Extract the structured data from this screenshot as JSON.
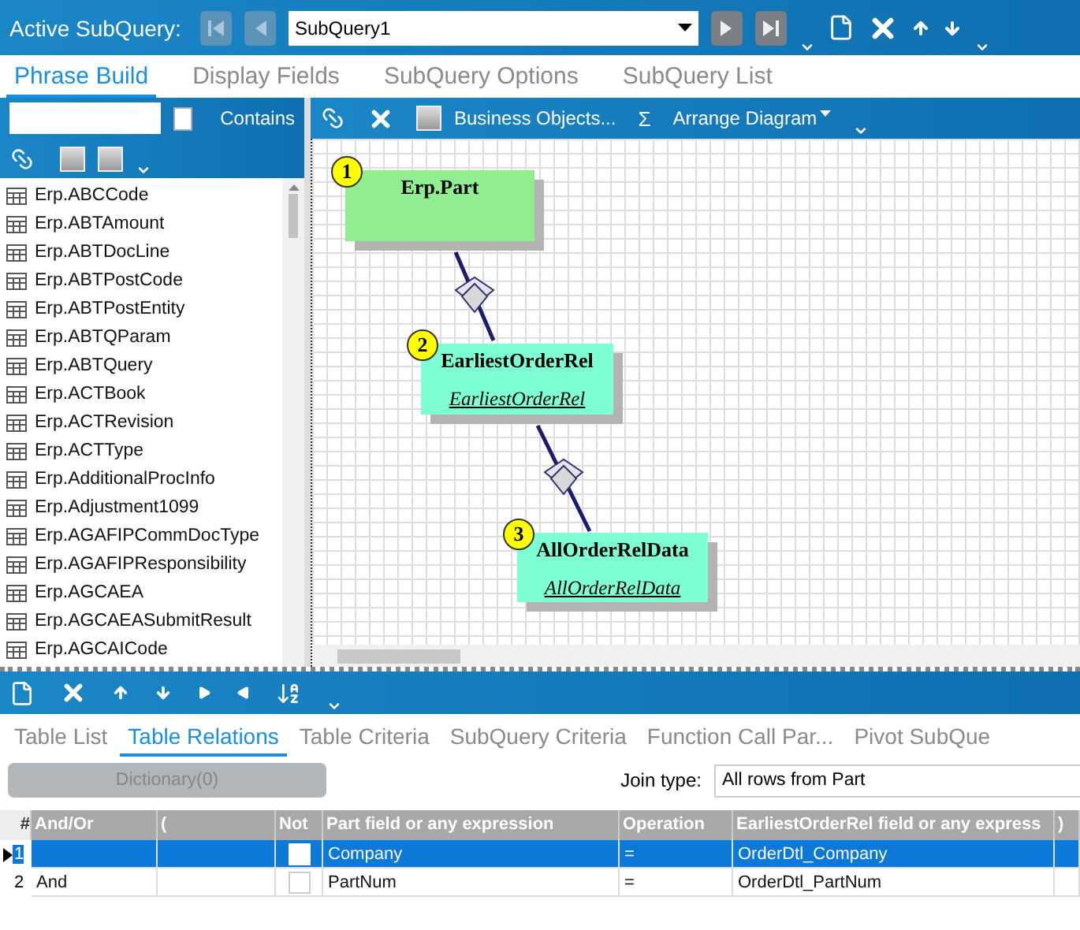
{
  "top_bar": {
    "label": "Active SubQuery:",
    "subquery": "SubQuery1"
  },
  "tabs": [
    {
      "label": "Phrase Build",
      "selected": true
    },
    {
      "label": "Display Fields",
      "selected": false
    },
    {
      "label": "SubQuery Options",
      "selected": false
    },
    {
      "label": "SubQuery List",
      "selected": false
    }
  ],
  "left_panel": {
    "contains_label": "Contains",
    "contains_checked": false,
    "items": [
      "Erp.ABCCode",
      "Erp.ABTAmount",
      "Erp.ABTDocLine",
      "Erp.ABTPostCode",
      "Erp.ABTPostEntity",
      "Erp.ABTQParam",
      "Erp.ABTQuery",
      "Erp.ACTBook",
      "Erp.ACTRevision",
      "Erp.ACTType",
      "Erp.AdditionalProcInfo",
      "Erp.Adjustment1099",
      "Erp.AGAFIPCommDocType",
      "Erp.AGAFIPResponsibility",
      "Erp.AGCAEA",
      "Erp.AGCAEASubmitResult",
      "Erp.AGCAICode"
    ]
  },
  "diagram_toolbar": {
    "business_objects": "Business Objects...",
    "sigma": "Σ",
    "arrange": "Arrange Diagram"
  },
  "diagram": {
    "nodes": [
      {
        "badge": "1",
        "title": "Erp.Part",
        "color": "#90ee90"
      },
      {
        "badge": "2",
        "title": "EarliestOrderRel",
        "subtitle": "EarliestOrderRel",
        "color": "#7fffd4"
      },
      {
        "badge": "3",
        "title": "AllOrderRelData",
        "subtitle": "AllOrderRelData",
        "color": "#7fffd4"
      }
    ]
  },
  "bottom_tabs": [
    {
      "label": "Table List",
      "selected": false
    },
    {
      "label": "Table Relations",
      "selected": true
    },
    {
      "label": "Table Criteria",
      "selected": false
    },
    {
      "label": "SubQuery Criteria",
      "selected": false
    },
    {
      "label": "Function Call Par...",
      "selected": false
    },
    {
      "label": "Pivot SubQue",
      "selected": false
    }
  ],
  "dictionary_button": {
    "label": "Dictionary(0)",
    "disabled": true
  },
  "join_type": {
    "label": "Join type:",
    "value": "All rows from Part"
  },
  "grid": {
    "columns": [
      "#",
      "And/Or",
      "(",
      "Not",
      "Part field or any expression",
      "Operation",
      "EarliestOrderRel field or any express",
      ")"
    ],
    "rows": [
      {
        "number": "1",
        "not": false,
        "field": "Company",
        "operation": "=",
        "related_field": "OrderDtl_Company",
        "selected": true
      },
      {
        "number": "2",
        "and_or": "And",
        "not": false,
        "field": "PartNum",
        "operation": "=",
        "related_field": "OrderDtl_PartNum",
        "selected": false
      }
    ]
  }
}
